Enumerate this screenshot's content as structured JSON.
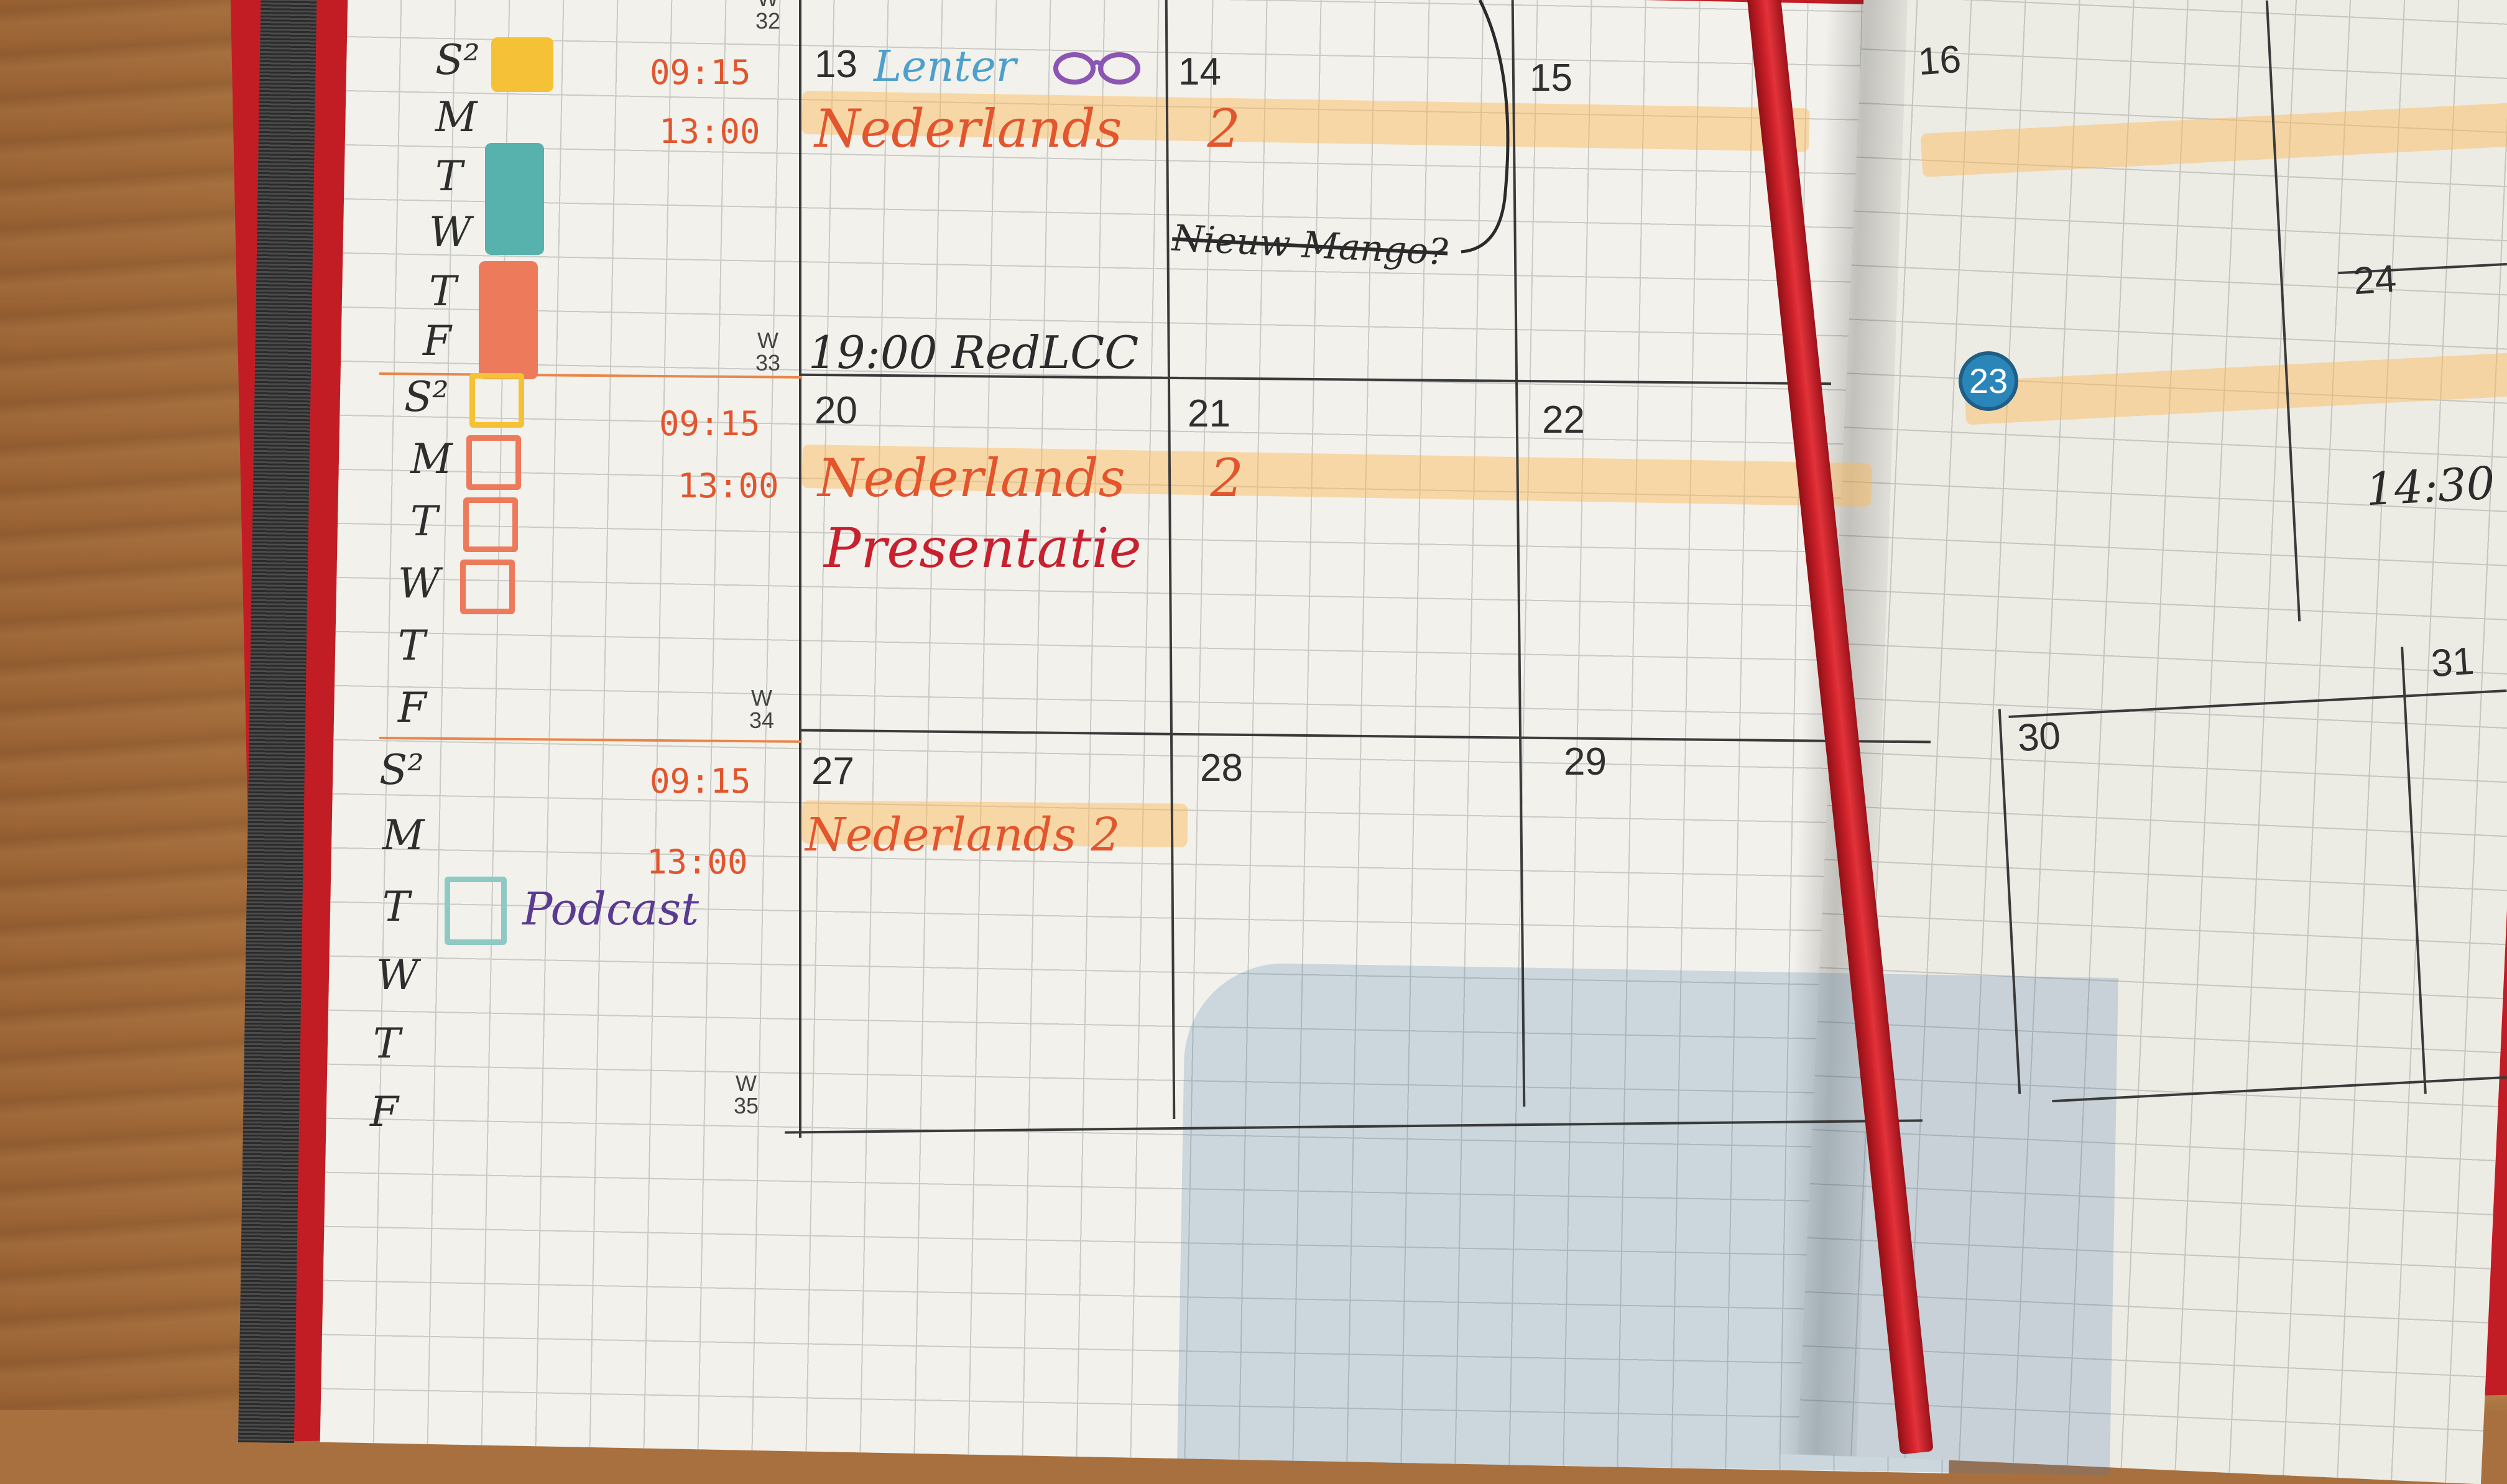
{
  "colors": {
    "orange": "#e2552d",
    "red": "#c8202e",
    "black": "#2b2b2b",
    "teal": "#4aa9a4",
    "yellow": "#f5c136",
    "purple": "#5a3b91",
    "blue": "#4ea0cc",
    "badge": "#2a86b8"
  },
  "weekday_labels": [
    [
      "S²",
      "M",
      "T",
      "W",
      "T",
      "F"
    ],
    [
      "S²",
      "M",
      "T",
      "W",
      "T",
      "F"
    ],
    [
      "S²",
      "M",
      "T",
      "W",
      "T",
      "F"
    ]
  ],
  "week_numbers": [
    "W 32",
    "W 33",
    "W 34",
    "W 35"
  ],
  "dates_left_page": [
    "13",
    "14",
    "15",
    "20",
    "21",
    "22",
    "27",
    "28",
    "29"
  ],
  "dates_right_page": [
    "16",
    "23",
    "24",
    "30",
    "31"
  ],
  "times": [
    "09:15",
    "13:00",
    "09:15",
    "13:00",
    "09:15",
    "13:00"
  ],
  "entries": {
    "lenter": "Lenter",
    "nederlands_1": "Nederlands 2",
    "nederlands_2": "Nederlands 2",
    "nederlands_3": "Nederlands 2",
    "presentatie": "Presentatie",
    "redlcc": "19:00 RedLCC",
    "crossed": "Nieuw Mango?",
    "podcast": "Podcast",
    "right_time": "14:30"
  }
}
